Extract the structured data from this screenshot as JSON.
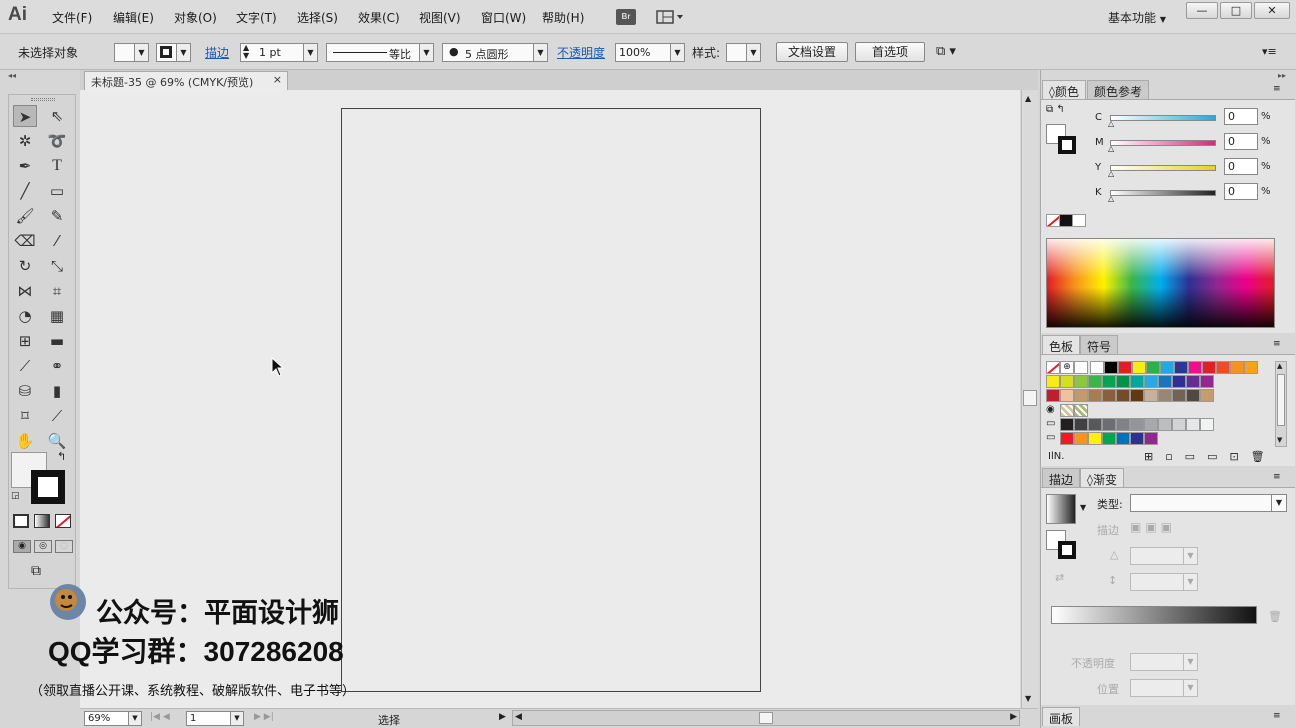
{
  "app": {
    "logo": "Ai"
  },
  "menu": [
    "文件(F)",
    "编辑(E)",
    "对象(O)",
    "文字(T)",
    "选择(S)",
    "效果(C)",
    "视图(V)",
    "窗口(W)",
    "帮助(H)"
  ],
  "bridge_label": "Br",
  "workspace": "基本功能",
  "window_buttons": [
    "—",
    "□",
    "✕"
  ],
  "control": {
    "selection": "未选择对象",
    "stroke_label": "描边",
    "stroke_weight": "1 pt",
    "stroke_profile": "等比",
    "brush": "5 点圆形",
    "opacity_label": "不透明度",
    "opacity": "100%",
    "style_label": "样式",
    "doc_setup": "文档设置",
    "preferences": "首选项"
  },
  "document": {
    "tab_title": "未标题-35 @ 69% (CMYK/预览)"
  },
  "status": {
    "zoom": "69%",
    "page": "1",
    "tool": "选择"
  },
  "color_panel": {
    "tabs": [
      "颜色",
      "颜色参考"
    ],
    "channels": [
      {
        "name": "C",
        "value": "0",
        "unit": "%",
        "color": "#29a8d6"
      },
      {
        "name": "M",
        "value": "0",
        "unit": "%",
        "color": "#d6297a"
      },
      {
        "name": "Y",
        "value": "0",
        "unit": "%",
        "color": "#e6d21c"
      },
      {
        "name": "K",
        "value": "0",
        "unit": "%",
        "color": "#222222"
      }
    ]
  },
  "swatches_panel": {
    "tabs": [
      "色板",
      "符号"
    ],
    "rows": [
      [
        "#ffffff",
        "#000000",
        "#e21d25",
        "#f7ec13",
        "#2db24b",
        "#22a9e1",
        "#2a388f",
        "#ec118a",
        "#e31f26",
        "#ef4b25",
        "#f6921e",
        "#f9a11b"
      ],
      [
        "#f7ec13",
        "#d6de23",
        "#8dc63f",
        "#3ab54a",
        "#00a651",
        "#009345",
        "#00a79d",
        "#27aae1",
        "#1b75bc",
        "#2e3192",
        "#662d91",
        "#92278f"
      ],
      [
        "#be1e2d",
        "#f0c19a",
        "#c49a6c",
        "#a97c50",
        "#8b5e3c",
        "#754c29",
        "#603913",
        "#c7b299",
        "#998675",
        "#736357",
        "#534741",
        "#c69c6d"
      ],
      [
        "#231f20",
        "#414042",
        "#58595b",
        "#6d6e71",
        "#808285",
        "#939598",
        "#a7a9ac",
        "#bcbec0",
        "#d1d3d4",
        "#e6e7e8",
        "#f1f2f2"
      ],
      [
        "#ed1c24",
        "#f7941d",
        "#fff200",
        "#00a651",
        "#0072bc",
        "#2e3192",
        "#92278f"
      ]
    ]
  },
  "gradient_panel": {
    "tabs": [
      "描边",
      "渐变"
    ],
    "type_label": "类型",
    "stroke_label": "描边",
    "opacity_label": "不透明度",
    "position_label": "位置"
  },
  "artboard_panel": {
    "tab": "画板"
  },
  "watermark": {
    "line1": "公众号：平面设计狮",
    "line2": "QQ学习群：307286208",
    "line3": "（领取直播公开课、系统教程、破解版软件、电子书等）"
  }
}
